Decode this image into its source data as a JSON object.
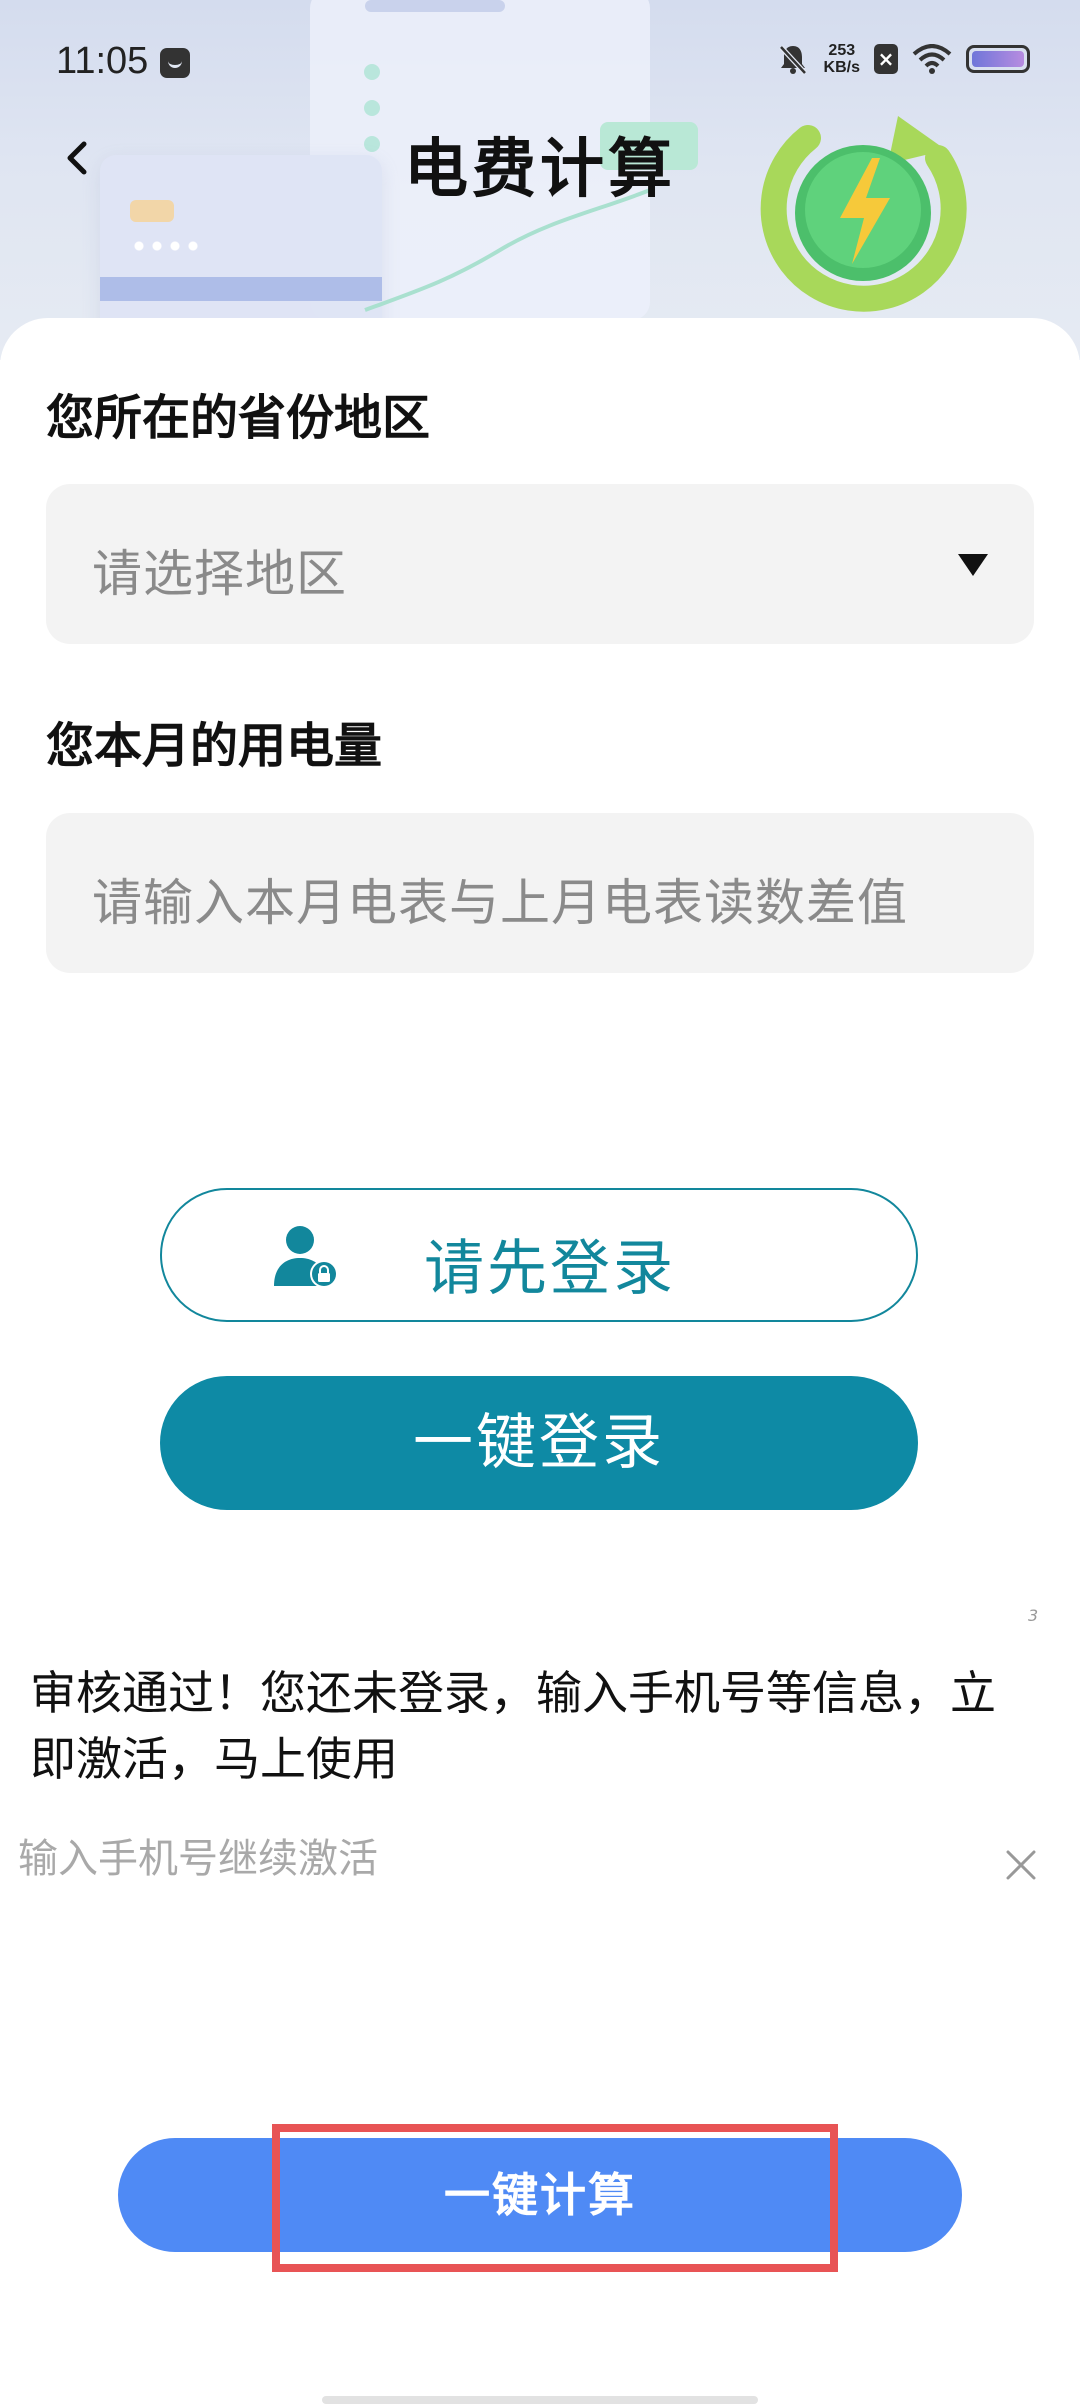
{
  "status_bar": {
    "time": "11:05",
    "net_speed_value": "253",
    "net_speed_unit": "KB/s",
    "x_badge": "×"
  },
  "header": {
    "title": "电费计算"
  },
  "form": {
    "region_label": "您所在的省份地区",
    "region_placeholder": "请选择地区",
    "usage_label": "您本月的用电量",
    "usage_placeholder": "请输入本月电表与上月电表读数差值"
  },
  "login": {
    "outline_label": "请先登录",
    "quick_login_label": "一键登录"
  },
  "notice": {
    "message": "审核通过！您还未登录，输入手机号等信息，立即激活，马上使用",
    "hint": "输入手机号继续激活",
    "corner_mark": "3"
  },
  "actions": {
    "calculate_label": "一键计算"
  },
  "colors": {
    "teal": "#0e8aa5",
    "blue_button": "#4f8af5",
    "highlight": "#e85455"
  }
}
